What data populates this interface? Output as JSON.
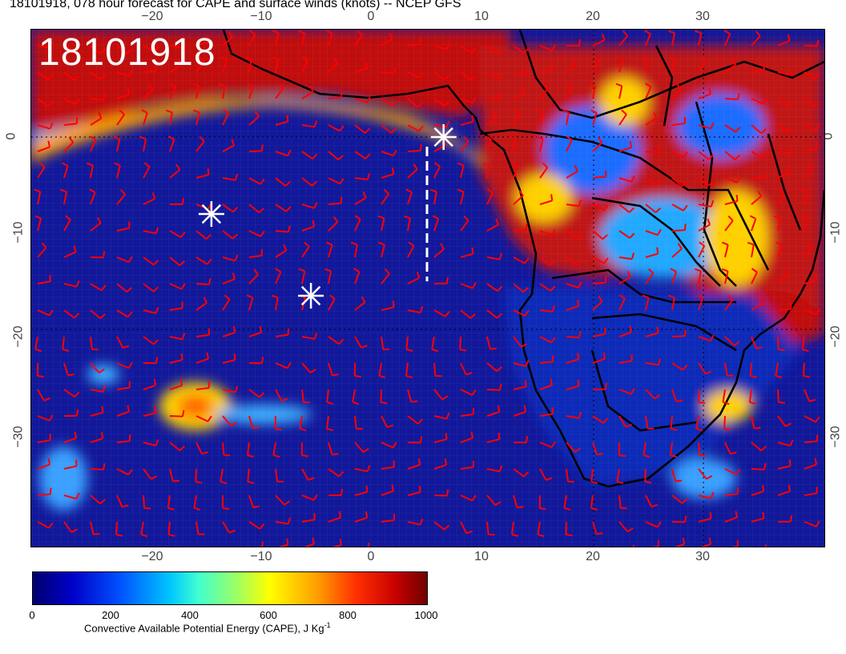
{
  "title": "18101918, 078 hour forecast for CAPE and surface winds (knots) -- NCEP GFS",
  "datestamp": "18101918",
  "axes": {
    "lon_ticks_top": [
      "−20",
      "−10",
      "0",
      "10",
      "20",
      "30"
    ],
    "lon_ticks_bottom": [
      "−20",
      "−10",
      "0",
      "10",
      "20",
      "30"
    ],
    "lat_ticks_left": [
      "0",
      "−10",
      "−20",
      "−30"
    ],
    "lat_ticks_right": [
      "0",
      "−10",
      "−20",
      "−30"
    ]
  },
  "colorbar": {
    "labels": [
      "0",
      "200",
      "400",
      "600",
      "800",
      "1000"
    ],
    "title": "Convective Available Potential Energy (CAPE), J Kg",
    "title_sup": "-1",
    "colors": [
      "#00006e",
      "#0000c8",
      "#0050ff",
      "#00c8ff",
      "#ffff00",
      "#ffa000",
      "#ff3000",
      "#c80000",
      "#6e0000"
    ]
  },
  "markers": {
    "symbol": "asterisk",
    "color": "#ffffff",
    "points": [
      {
        "lon": -14.5,
        "lat": -8.0
      },
      {
        "lon": -5.5,
        "lat": -16.5
      },
      {
        "lon": 6.5,
        "lat": 0.0
      }
    ]
  },
  "track_line": {
    "color": "#ffffff",
    "style": "dashed",
    "from": {
      "lon": 5.0,
      "lat": -1.0
    },
    "to": {
      "lon": 5.0,
      "lat": -15.0
    }
  },
  "wind_barb_color": "#ff0000",
  "land_border_color": "#000000"
}
